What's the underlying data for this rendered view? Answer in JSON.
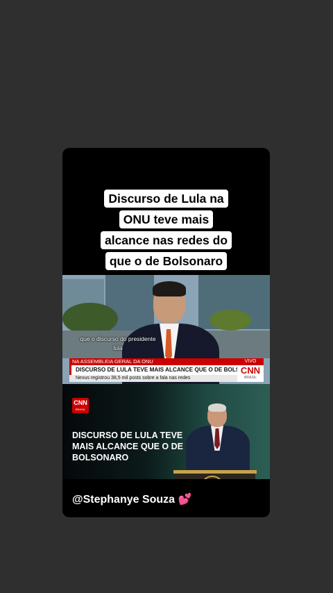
{
  "post": {
    "title": "Discurso de Lula na ONU teve mais alcance nas redes do que o de Bolsonaro",
    "handle": "@Stephanye Souza",
    "heart_emoji": "💕"
  },
  "news_clip": {
    "subtitle": "que o discurso do presidente lula",
    "strip_label": "NA ASSEMBLEIA GERAL DA ONU",
    "live_label": "VIVO",
    "headline": "DISCURSO DE LULA TEVE MAIS ALCANCE QUE O DE BOLSONARO",
    "subline": "Nexus registrou 38,5 mil posts sobre a fala nas redes",
    "logo_text": "CNN",
    "logo_sub": "BRASIL"
  },
  "clip2": {
    "logo_text": "CNN",
    "logo_sub": "BRASIL",
    "headline": "DISCURSO DE LULA TEVE MAIS ALCANCE QUE O DE BOLSONARO"
  },
  "colors": {
    "background": "#2f2f2f",
    "cnn_red": "#cc0000",
    "un_gold": "#c9a24a"
  },
  "icons": [
    "heart-icon",
    "un-emblem-icon",
    "cnn-logo"
  ]
}
